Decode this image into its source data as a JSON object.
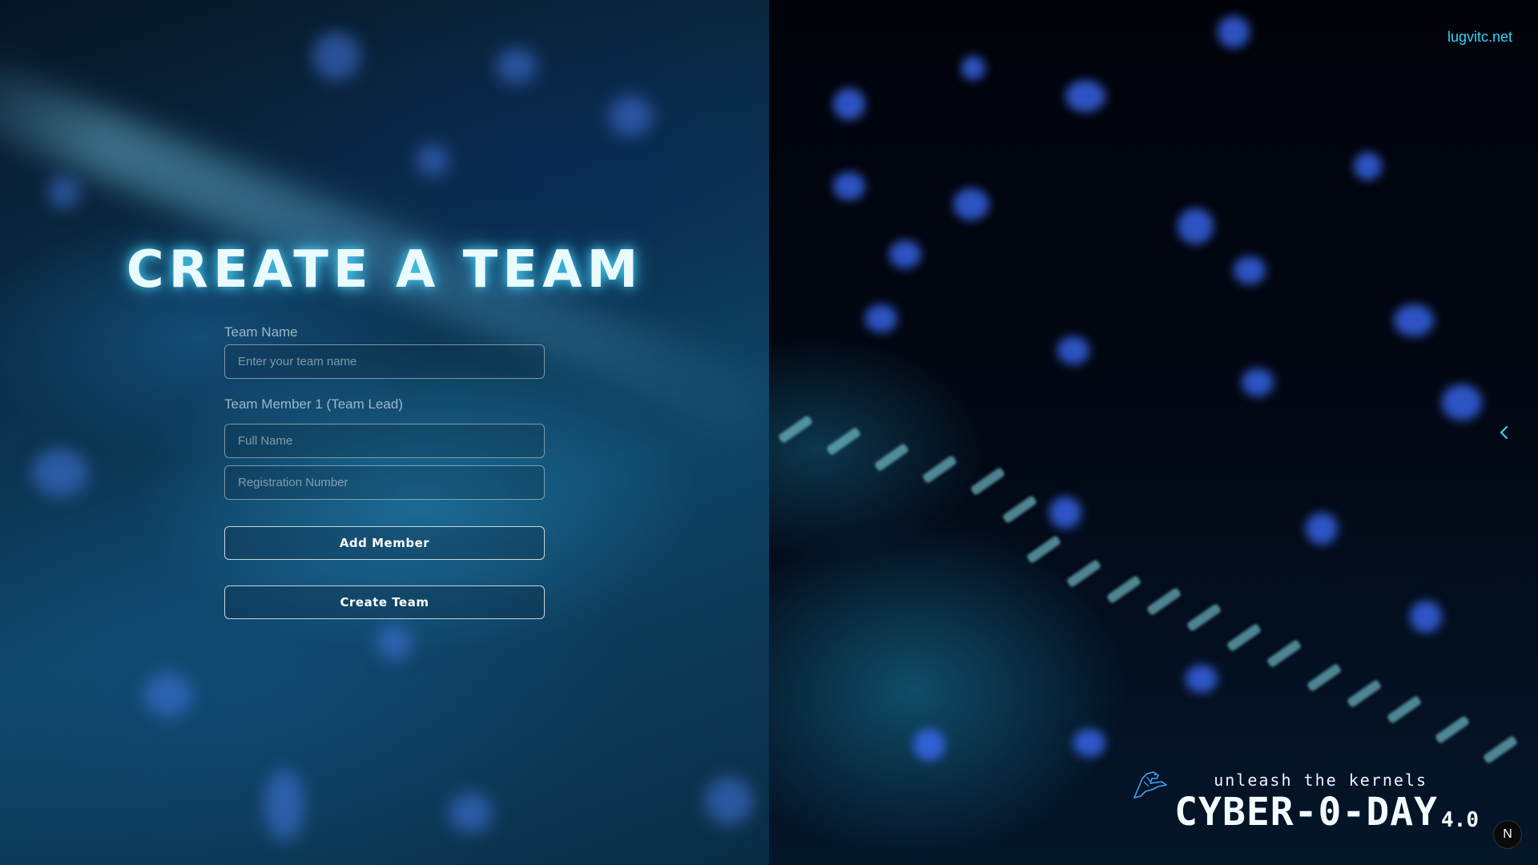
{
  "header": {
    "site_link": "lugvitc.net"
  },
  "form": {
    "title": "CREATE A TEAM",
    "team_name": {
      "label": "Team Name",
      "placeholder": "Enter your team name",
      "value": ""
    },
    "member1": {
      "label": "Team Member 1 (Team Lead)",
      "full_name_placeholder": "Full Name",
      "reg_number_placeholder": "Registration Number"
    },
    "add_member_label": "Add Member",
    "create_team_label": "Create Team"
  },
  "branding": {
    "tagline": "unleash the kernels",
    "event_name": "CYBER-0-DAY",
    "version": "4.0"
  },
  "misc": {
    "badge_letter": "N",
    "chevron_icon": "chevron-left-icon"
  },
  "colors": {
    "accent": "#2fd3ff",
    "title_glow": "#50dcff"
  }
}
